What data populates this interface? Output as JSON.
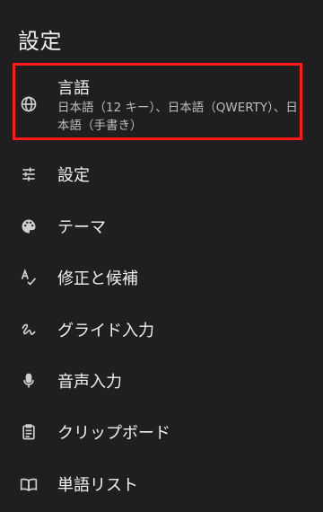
{
  "page": {
    "title": "設定"
  },
  "highlight_color": "#ff1a1a",
  "menu": {
    "language": {
      "title": "言語",
      "subtitle": "日本語（12 キー）、日本語（QWERTY）、日本語（手書き）",
      "icon": "globe-icon"
    },
    "items": [
      {
        "label": "設定",
        "icon": "sliders-icon"
      },
      {
        "label": "テーマ",
        "icon": "palette-icon"
      },
      {
        "label": "修正と候補",
        "icon": "spellcheck-icon"
      },
      {
        "label": "グライド入力",
        "icon": "gesture-icon"
      },
      {
        "label": "音声入力",
        "icon": "microphone-icon"
      },
      {
        "label": "クリップボード",
        "icon": "clipboard-icon"
      },
      {
        "label": "単語リスト",
        "icon": "book-icon"
      }
    ]
  }
}
